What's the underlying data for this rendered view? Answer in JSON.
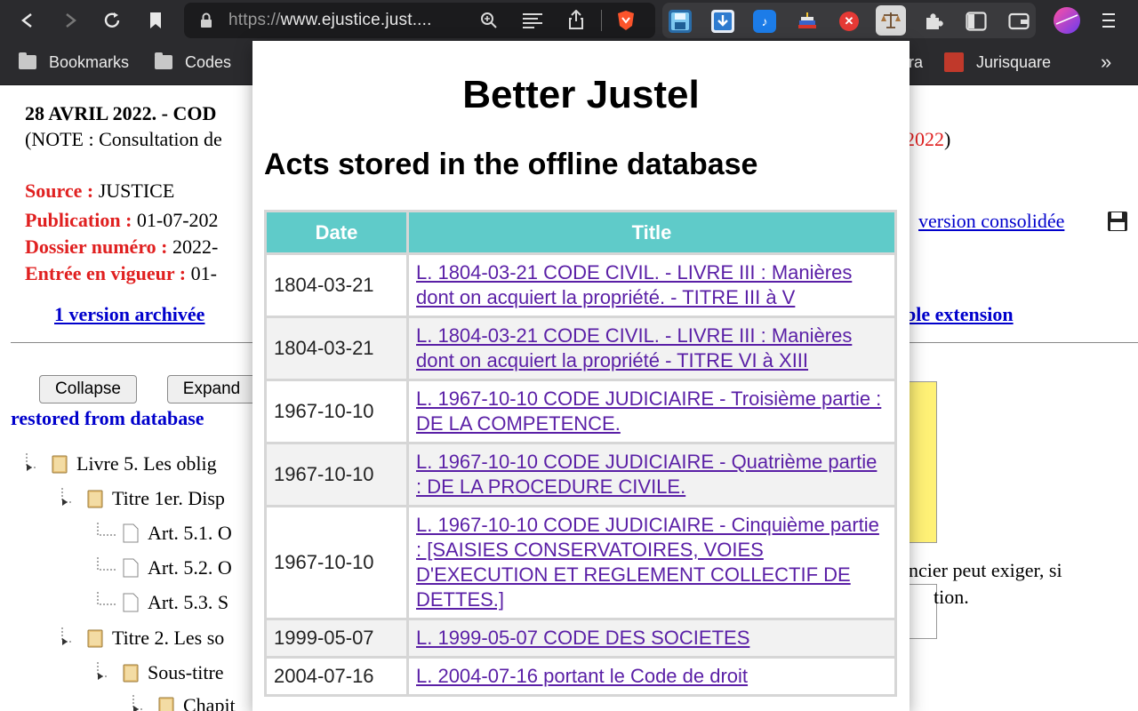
{
  "browser": {
    "url_scheme": "https://",
    "url_rest": "www.ejustice.just....",
    "bookmarks": [
      {
        "label": "Bookmarks"
      },
      {
        "label": "Codes"
      },
      {
        "label": "ra"
      },
      {
        "label": "Jurisquare"
      }
    ],
    "more_label": "»"
  },
  "page": {
    "title": "28 AVRIL 2022. - COD",
    "note_left": "(NOTE : Consultation de",
    "note_year": "2022",
    "note_close": ")",
    "source_label": "Source :",
    "source_value": "JUSTICE",
    "publication_label": "Publication :",
    "publication_value": "01-07-202",
    "dossier_label": "Dossier numéro :",
    "dossier_value": "2022-",
    "entree_label": "Entrée en vigueur :",
    "entree_value": "01-",
    "archived_link": "1 version archivée",
    "consolidated_link": "version consolidée",
    "extension_link": "ble extension",
    "collapse_btn": "Collapse",
    "expand_btn": "Expand",
    "restored_text": "restored from database",
    "tree": [
      {
        "text": "Livre 5. Les oblig",
        "type": "folder"
      },
      {
        "text": "Titre 1er. Disp",
        "type": "folder"
      },
      {
        "text": "Art. 5.1. O",
        "type": "doc"
      },
      {
        "text": "Art. 5.2. O",
        "type": "doc"
      },
      {
        "text": "Art. 5.3. S",
        "type": "doc"
      },
      {
        "text": "Titre 2. Les so",
        "type": "folder"
      },
      {
        "text": "Sous-titre",
        "type": "folder"
      },
      {
        "text": "Chapit",
        "type": "folder"
      }
    ],
    "right_line1": "ncier peut exiger, si",
    "right_line2": "tion."
  },
  "popup": {
    "heading": "Better Justel",
    "subheading": "Acts stored in the offline database",
    "col_date": "Date",
    "col_title": "Title",
    "rows": [
      {
        "date": "1804-03-21",
        "title": "L. 1804-03-21 CODE CIVIL. - LIVRE III : Manières dont on acquiert la propriété. - TITRE III à V"
      },
      {
        "date": "1804-03-21",
        "title": "L. 1804-03-21 CODE CIVIL. - LIVRE III : Manières dont on acquiert la propriété - TITRE VI à XIII"
      },
      {
        "date": "1967-10-10",
        "title": "L. 1967-10-10 CODE JUDICIAIRE - Troisième partie : DE LA COMPETENCE."
      },
      {
        "date": "1967-10-10",
        "title": "L. 1967-10-10 CODE JUDICIAIRE - Quatrième partie : DE LA PROCEDURE CIVILE."
      },
      {
        "date": "1967-10-10",
        "title": "L. 1967-10-10 CODE JUDICIAIRE - Cinquième partie : [SAISIES CONSERVATOIRES, VOIES D'EXECUTION ET REGLEMENT COLLECTIF DE DETTES.]"
      },
      {
        "date": "1999-05-07",
        "title": "L. 1999-05-07 CODE DES SOCIETES"
      },
      {
        "date": "2004-07-16",
        "title": "L. 2004-07-16 portant le Code de droit"
      }
    ]
  }
}
